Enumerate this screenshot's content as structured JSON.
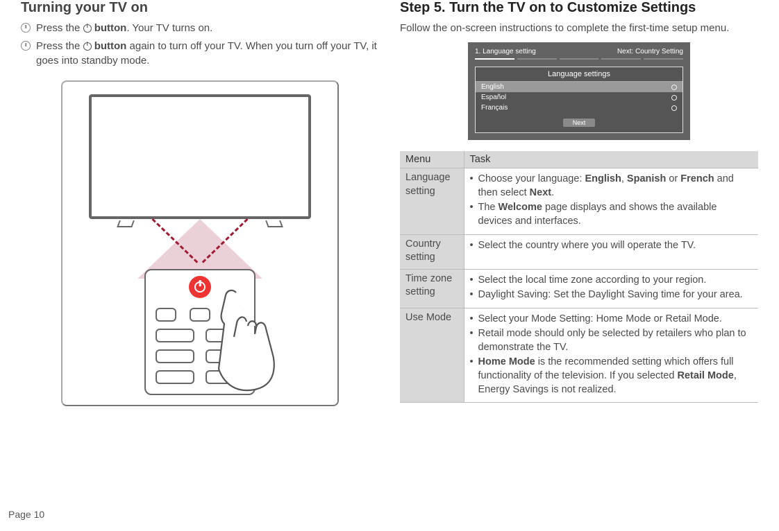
{
  "pageNumber": "Page 10",
  "left": {
    "heading": "Turning your TV on",
    "bullets": [
      {
        "pre": "Press the ",
        "mid": "button",
        "post": ". Your TV turns on."
      },
      {
        "pre": "Press the ",
        "mid": "button",
        "post": " again to turn off your TV. When you turn off your TV, it goes into standby mode."
      }
    ]
  },
  "right": {
    "heading": "Step 5. Turn the TV on to Customize Settings",
    "intro": "Follow the on-screen instructions to complete the first-time setup menu.",
    "osd": {
      "stepLabel": "1. Language setting",
      "nextLabel": "Next: Country Setting",
      "panelTitle": "Language settings",
      "options": [
        "English",
        "Español",
        "Français"
      ],
      "selectedIndex": 0,
      "nextButton": "Next"
    },
    "table": {
      "headers": [
        "Menu",
        "Task"
      ],
      "rows": [
        {
          "menu": "Language setting",
          "tasks": [
            "Choose your language: <b>English</b>, <b>Spanish</b> or <b>French</b> and then select <b>Next</b>.",
            "The <b>Welcome</b> page displays and shows the available devices and interfaces."
          ]
        },
        {
          "menu": "Country setting",
          "tasks": [
            "Select the country where you will operate the TV."
          ]
        },
        {
          "menu": "Time zone setting",
          "tasks": [
            "Select the local time zone according to your region.",
            "Daylight Saving: Set the Daylight Saving time for your area."
          ]
        },
        {
          "menu": "Use Mode",
          "tasks": [
            "Select your Mode Setting: Home Mode or Retail Mode.",
            "Retail mode should only be selected by retailers who plan to demonstrate the TV.",
            "<b>Home Mode</b> is the recommended setting which offers full functionality of the television. If you selected <b>Retail Mode</b>, Energy Savings is not realized."
          ]
        }
      ]
    }
  }
}
